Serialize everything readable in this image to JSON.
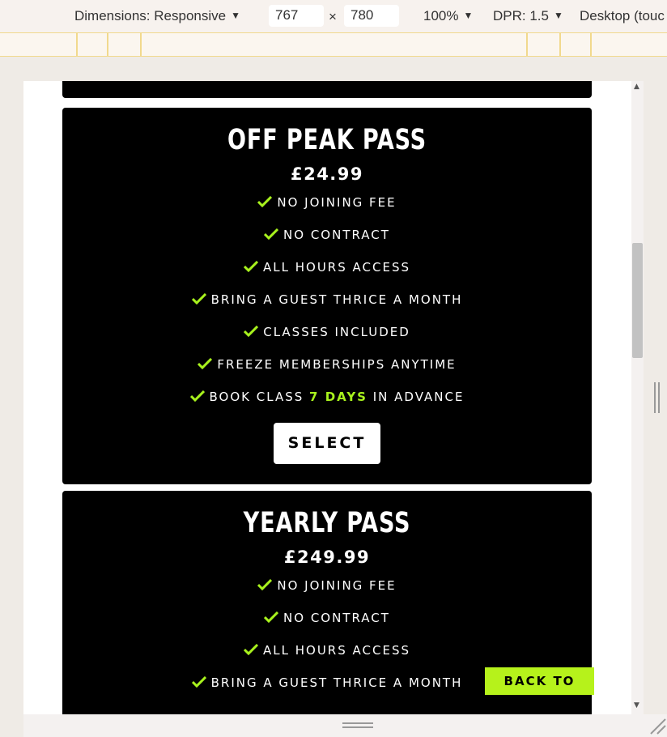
{
  "devtools": {
    "dimensions_label": "Dimensions: Responsive",
    "width": "767",
    "height": "780",
    "times": "×",
    "zoom": "100%",
    "dpr": "DPR: 1.5",
    "device_mode": "Desktop (touc"
  },
  "colors": {
    "accent": "#a8f21d",
    "card_bg": "#000000",
    "back_to_top_bg": "#b6f21b"
  },
  "cards": [
    {
      "title": "OFF PEAK PASS",
      "price": "£24.99",
      "features": [
        "NO JOINING FEE",
        "NO CONTRACT",
        "ALL HOURS ACCESS",
        "BRING A GUEST THRICE A MONTH",
        "CLASSES INCLUDED",
        "FREEZE MEMBERSHIPS ANYTIME"
      ],
      "book_feature": {
        "prefix": "BOOK CLASS ",
        "highlight": "7 DAYS",
        "suffix": " IN ADVANCE"
      },
      "select_label": "SELECT"
    },
    {
      "title": "YEARLY PASS",
      "price": "£249.99",
      "features": [
        "NO JOINING FEE",
        "NO CONTRACT",
        "ALL HOURS ACCESS",
        "BRING A GUEST THRICE A MONTH"
      ]
    }
  ],
  "back_to_top_label": "BACK TO TOP"
}
